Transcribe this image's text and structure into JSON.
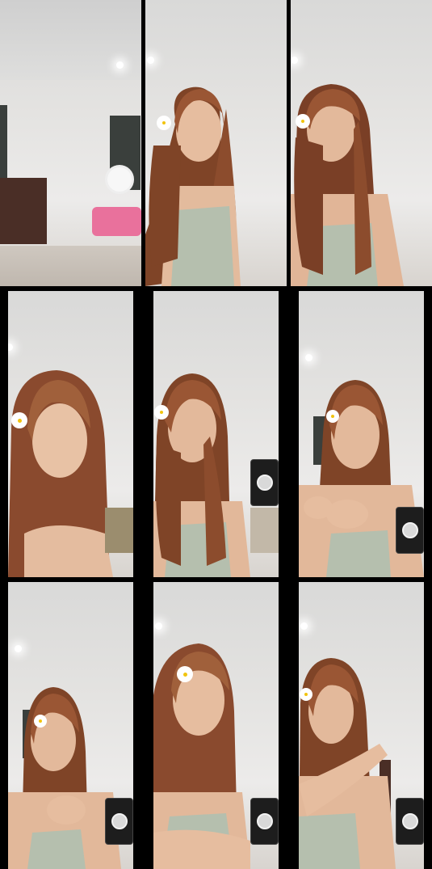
{
  "screen": {
    "background": "#000000"
  },
  "grid": {
    "tiles": [
      {
        "id": "r1c1",
        "scene": "room-empty"
      },
      {
        "id": "r1c2",
        "scene": "woman-smiling"
      },
      {
        "id": "r1c3",
        "scene": "woman-talking"
      },
      {
        "id": "r2c1",
        "scene": "woman-closeup",
        "has_side_thumbnail": true
      },
      {
        "id": "r2c2",
        "scene": "woman-center",
        "has_pip": true,
        "has_side_thumbnail": true
      },
      {
        "id": "r2c3",
        "scene": "woman-hands",
        "has_pip": true
      },
      {
        "id": "r3c1",
        "scene": "woman-smiling-down",
        "has_pip": true
      },
      {
        "id": "r3c2",
        "scene": "woman-looking-side",
        "has_pip": true
      },
      {
        "id": "r3c3",
        "scene": "woman-arms-crossed",
        "has_pip": true
      }
    ]
  },
  "icons": {
    "pip_avatar": "user-avatar-icon",
    "hair_flower": "flower-icon"
  },
  "colors": {
    "hair": "#8a4a2e",
    "skin": "#e9c3a6",
    "flower": "#ffffff",
    "flower_center": "#f1c40f",
    "top": "#b5bfae",
    "pip_bg": "#1d1d1d"
  }
}
